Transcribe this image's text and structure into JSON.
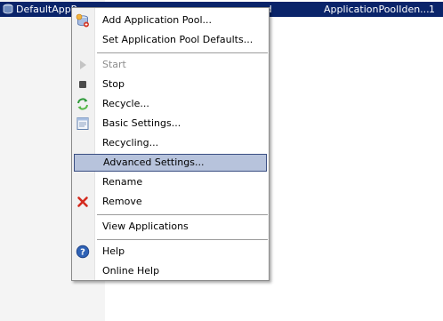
{
  "list_row": {
    "name": "DefaultAppPo",
    "status": "ed",
    "identity": "ApplicationPoolIden...",
    "apps": "1"
  },
  "context_menu": {
    "items": [
      {
        "label": "Add Application Pool...",
        "icon": "add-app-pool-icon",
        "enabled": true
      },
      {
        "label": "Set Application Pool Defaults...",
        "enabled": true
      },
      {
        "label": "Start",
        "icon": "start-icon",
        "enabled": false
      },
      {
        "label": "Stop",
        "icon": "stop-icon",
        "enabled": true
      },
      {
        "label": "Recycle...",
        "icon": "recycle-icon",
        "enabled": true
      },
      {
        "label": "Basic Settings...",
        "icon": "basic-settings-icon",
        "enabled": true
      },
      {
        "label": "Recycling...",
        "enabled": true
      },
      {
        "label": "Advanced Settings...",
        "enabled": true,
        "highlighted": true
      },
      {
        "label": "Rename",
        "enabled": true
      },
      {
        "label": "Remove",
        "icon": "remove-icon",
        "enabled": true
      },
      {
        "label": "View Applications",
        "enabled": true
      },
      {
        "label": "Help",
        "icon": "help-icon",
        "enabled": true
      },
      {
        "label": "Online Help",
        "enabled": true
      }
    ]
  },
  "colors": {
    "selection": "#0a246a",
    "highlight_fill": "#b7c3dc",
    "highlight_border": "#3a4e82",
    "disabled_text": "#8d8d8d",
    "remove_icon": "#d42a1e",
    "help_icon": "#2f62b5"
  }
}
